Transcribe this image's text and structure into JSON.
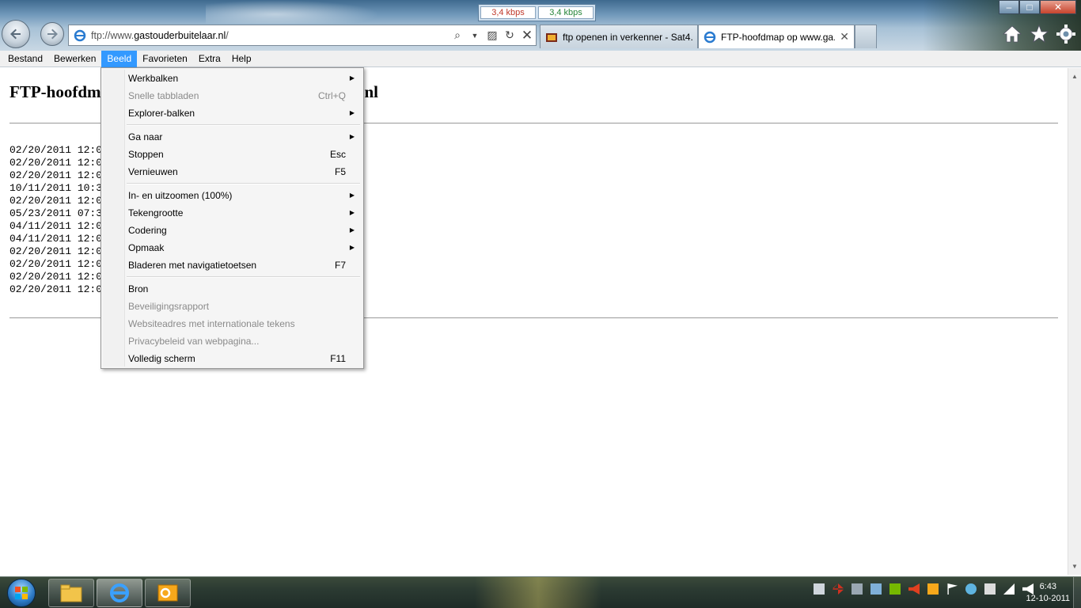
{
  "browser": {
    "address_url_prefix": "ftp://www.",
    "address_url_domain": "gastouderbuitelaar.nl",
    "address_url_suffix": "/",
    "speed_down": "3,4 kbps",
    "speed_up": "3,4 kbps",
    "tabs": [
      {
        "title": "ftp openen in verkenner - Sat4...",
        "active": false
      },
      {
        "title": "FTP-hoofdmap op www.ga...",
        "active": true
      }
    ]
  },
  "menubar": {
    "items": [
      "Bestand",
      "Bewerken",
      "Beeld",
      "Favorieten",
      "Extra",
      "Help"
    ]
  },
  "page": {
    "heading_left": "FTP-hoofdm",
    "heading_right": "nl",
    "listing": [
      "02/20/2011 12:0",
      "02/20/2011 12:0",
      "02/20/2011 12:0",
      "10/11/2011 10:3",
      "02/20/2011 12:0",
      "05/23/2011 07:3",
      "04/11/2011 12:0",
      "04/11/2011 12:0",
      "02/20/2011 12:0",
      "02/20/2011 12:0",
      "02/20/2011 12:0",
      "02/20/2011 12:0"
    ]
  },
  "dropdown": {
    "werkbalken": "Werkbalken",
    "snelle_tabbladen": "Snelle tabbladen",
    "snelle_tabbladen_key": "Ctrl+Q",
    "explorer_balken": "Explorer-balken",
    "ga_naar": "Ga naar",
    "stoppen": "Stoppen",
    "stoppen_key": "Esc",
    "vernieuwen": "Vernieuwen",
    "vernieuwen_key": "F5",
    "zoom": "In- en uitzoomen (100%)",
    "tekengrootte": "Tekengrootte",
    "codering": "Codering",
    "opmaak": "Opmaak",
    "bladeren": "Bladeren met navigatietoetsen",
    "bladeren_key": "F7",
    "bron": "Bron",
    "beveiliging": "Beveiligingsrapport",
    "websiteadres": "Websiteadres met internationale tekens",
    "privacy": "Privacybeleid van webpagina...",
    "volledig": "Volledig scherm",
    "volledig_key": "F11"
  },
  "taskbar": {
    "time": "6:43",
    "date": "12-10-2011"
  },
  "colors": {
    "menu_highlight": "#3399ff",
    "close_button": "#c6432c",
    "speed_down": "#c0392b",
    "speed_up": "#27863a"
  },
  "icons": [
    "back-arrow-icon",
    "forward-arrow-icon",
    "ie-logo-icon",
    "search-icon",
    "dropdown-icon",
    "compatibility-icon",
    "refresh-icon",
    "stop-icon",
    "home-icon",
    "favorites-star-icon",
    "gear-icon",
    "submenu-arrow-icon",
    "windows-start-icon",
    "explorer-folder-icon",
    "outlook-icon"
  ]
}
